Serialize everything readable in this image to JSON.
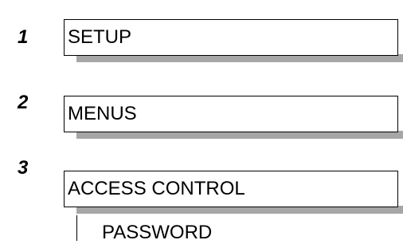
{
  "steps": [
    {
      "number": "1",
      "label": "SETUP"
    },
    {
      "number": "2",
      "label": "MENUS"
    },
    {
      "number": "3",
      "label": "ACCESS CONTROL"
    }
  ],
  "submenu": {
    "label": "PASSWORD"
  },
  "colors": {
    "box_border": "#000000",
    "shadow": "#a6a6a6",
    "text": "#000000",
    "background": "#ffffff"
  }
}
